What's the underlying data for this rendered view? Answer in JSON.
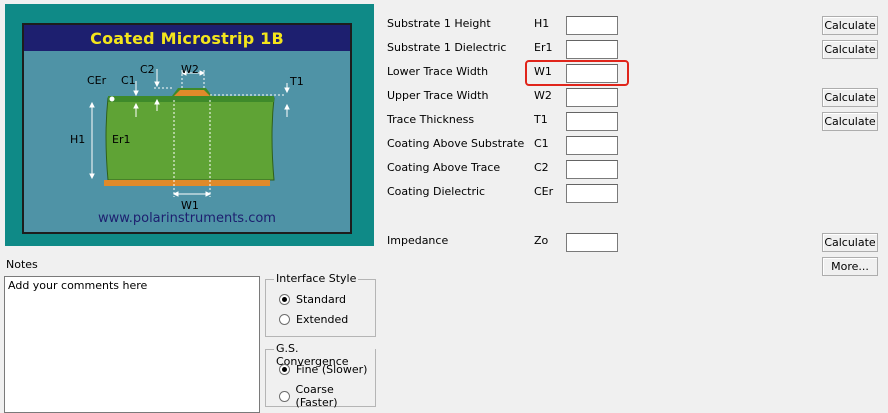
{
  "diagram": {
    "title": "Coated Microstrip 1B",
    "url": "www.polarinstruments.com",
    "labels": {
      "cer": "CEr",
      "c1": "C1",
      "c2": "C2",
      "w2": "W2",
      "t1": "T1",
      "h1": "H1",
      "er1": "Er1",
      "w1": "W1"
    }
  },
  "params": [
    {
      "label": "Substrate 1 Height",
      "symbol": "H1",
      "value": "",
      "button": "Calculate"
    },
    {
      "label": "Substrate 1 Dielectric",
      "symbol": "Er1",
      "value": "",
      "button": "Calculate"
    },
    {
      "label": "Lower Trace Width",
      "symbol": "W1",
      "value": "",
      "button": ""
    },
    {
      "label": "Upper Trace Width",
      "symbol": "W2",
      "value": "",
      "button": "Calculate"
    },
    {
      "label": "Trace Thickness",
      "symbol": "T1",
      "value": "",
      "button": "Calculate"
    },
    {
      "label": "Coating Above Substrate",
      "symbol": "C1",
      "value": "",
      "button": ""
    },
    {
      "label": "Coating Above Trace",
      "symbol": "C2",
      "value": "",
      "button": ""
    },
    {
      "label": "Coating Dielectric",
      "symbol": "CEr",
      "value": "",
      "button": ""
    }
  ],
  "impedance": {
    "label": "Impedance",
    "symbol": "Zo",
    "value": "",
    "button": "Calculate"
  },
  "more_button": "More...",
  "notes": {
    "label": "Notes",
    "text": "Add your comments here"
  },
  "interface_style": {
    "title": "Interface Style",
    "options": [
      {
        "label": "Standard",
        "selected": true
      },
      {
        "label": "Extended",
        "selected": false
      }
    ]
  },
  "gs_convergence": {
    "title": "G.S. Convergence",
    "options": [
      {
        "label": "Fine (Slower)",
        "selected": true
      },
      {
        "label": "Coarse (Faster)",
        "selected": false
      }
    ]
  },
  "colors": {
    "highlight": "#e0251b",
    "diagram_bg": "#0f8a87",
    "title_bar": "#1d1f6f",
    "title_text": "#f4e51c"
  }
}
